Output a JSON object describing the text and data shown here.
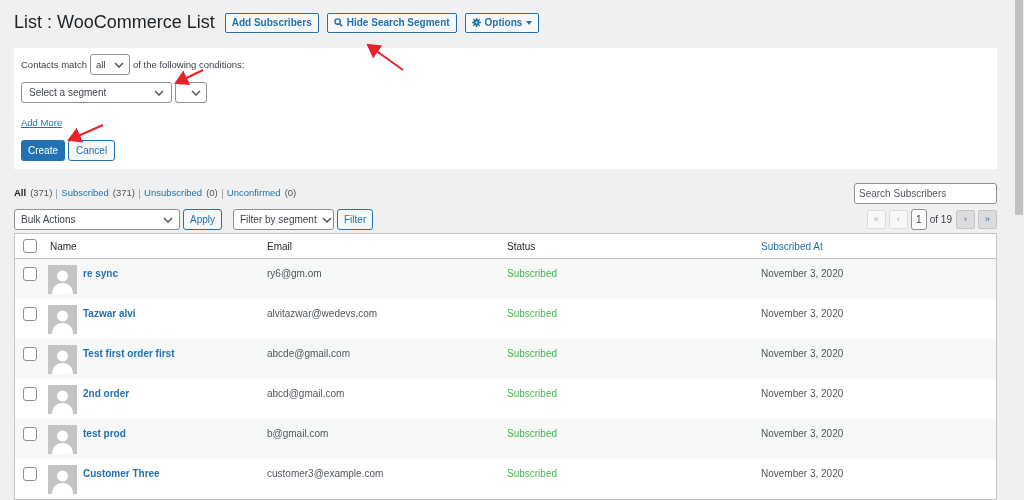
{
  "header": {
    "title": "List : WooCommerce List",
    "buttons": [
      {
        "label": "Add Subscribers",
        "kind": "plain"
      },
      {
        "label": "Hide Search Segment",
        "kind": "search"
      },
      {
        "label": "Options",
        "kind": "options"
      }
    ]
  },
  "segment_panel": {
    "prefix": "Contacts match",
    "match": "all",
    "suffix": "of the following conditions:",
    "segment_select": "Select a segment",
    "add_more": "Add More",
    "create": "Create",
    "cancel": "Cancel"
  },
  "views": [
    {
      "label": "All",
      "count": "(371)",
      "selected": true
    },
    {
      "label": "Subscribed",
      "count": "(371)",
      "selected": false
    },
    {
      "label": "Unsubscribed",
      "count": "(0)",
      "selected": false
    },
    {
      "label": "Unconfirmed",
      "count": "(0)",
      "selected": false
    }
  ],
  "search": {
    "placeholder": "Search Subscribers"
  },
  "toolbar": {
    "bulk_actions": "Bulk Actions",
    "apply": "Apply",
    "filter_select": "Filter by segment",
    "filter": "Filter"
  },
  "pagination": {
    "first": "«",
    "prev": "‹",
    "page": "1",
    "of": "of 19",
    "next": "›",
    "last": "»"
  },
  "table": {
    "select_all": {
      "checked": false
    },
    "columns": [
      {
        "label": "Name",
        "sortable": false
      },
      {
        "label": "Email",
        "sortable": false
      },
      {
        "label": "Status",
        "sortable": false
      },
      {
        "label": "Subscribed At",
        "sortable": true
      }
    ],
    "rows": [
      {
        "name": "re sync",
        "email": "ry6@gm.om",
        "status": "Subscribed",
        "date": "November 3, 2020",
        "checked": false
      },
      {
        "name": "Tazwar alvi",
        "email": "alvitazwar@wedevs.com",
        "status": "Subscribed",
        "date": "November 3, 2020",
        "checked": false
      },
      {
        "name": "Test first order first",
        "email": "abcde@gmail.com",
        "status": "Subscribed",
        "date": "November 3, 2020",
        "checked": false
      },
      {
        "name": "2nd order",
        "email": "abcd@gmail.com",
        "status": "Subscribed",
        "date": "November 3, 2020",
        "checked": false
      },
      {
        "name": "test prod",
        "email": "b@gmail.com",
        "status": "Subscribed",
        "date": "November 3, 2020",
        "checked": false
      },
      {
        "name": "Customer Three",
        "email": "customer3@example.com",
        "status": "Subscribed",
        "date": "November 3, 2020",
        "checked": false
      }
    ]
  }
}
